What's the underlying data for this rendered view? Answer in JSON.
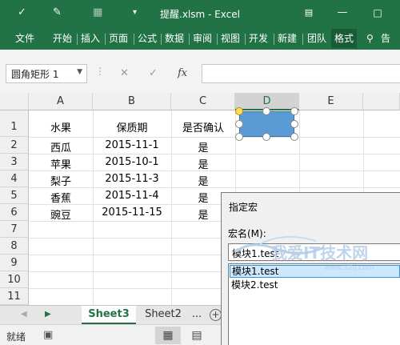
{
  "window": {
    "title": "提醒.xlsm - Excel",
    "quick_access": [
      "save-icon",
      "pen-icon",
      "table-icon",
      "caret-icon"
    ],
    "buttons": [
      "restore-icon",
      "minimize-icon",
      "maximize-icon",
      "close-icon"
    ]
  },
  "ribbon": {
    "tabs": [
      "文件",
      "开始",
      "插入",
      "页面",
      "公式",
      "数据",
      "审阅",
      "视图",
      "开发",
      "新建",
      "团队",
      "格式",
      "告"
    ],
    "active_tab": "格式",
    "bulb_icon": "lightbulb-icon"
  },
  "formula_bar": {
    "name_box": "圆角矩形 1",
    "fx_label": "fx",
    "formula_value": ""
  },
  "grid": {
    "columns": [
      "A",
      "B",
      "C",
      "D",
      "E"
    ],
    "selected_column": "D",
    "rows": [
      "1",
      "2",
      "3",
      "4",
      "5",
      "6",
      "7",
      "8",
      "9",
      "10",
      "11"
    ],
    "header_row": [
      "水果",
      "保质期",
      "是否确认"
    ],
    "data": [
      [
        "西瓜",
        "2015-11-1",
        "是"
      ],
      [
        "苹果",
        "2015-10-1",
        "是"
      ],
      [
        "梨子",
        "2015-11-3",
        "是"
      ],
      [
        "香蕉",
        "2015-11-4",
        "是"
      ],
      [
        "豌豆",
        "2015-11-15",
        "是"
      ]
    ]
  },
  "shape": {
    "name": "圆角矩形 1",
    "fill": "#5b9bd5"
  },
  "sheets": {
    "tabs": [
      "Sheet3",
      "Sheet2"
    ],
    "active": "Sheet3",
    "more": "..."
  },
  "status": {
    "text": "就绪"
  },
  "dialog": {
    "title": "指定宏",
    "label": "宏名(M):",
    "input_value": "模块1.test",
    "items": [
      "模块1.test",
      "模块2.test"
    ],
    "selected_index": 0
  },
  "watermark": {
    "text": "我爱IT技术网",
    "url": "www.52ij.com"
  },
  "colors": {
    "excel_green": "#217346",
    "selection_blue": "#cce8ff"
  }
}
